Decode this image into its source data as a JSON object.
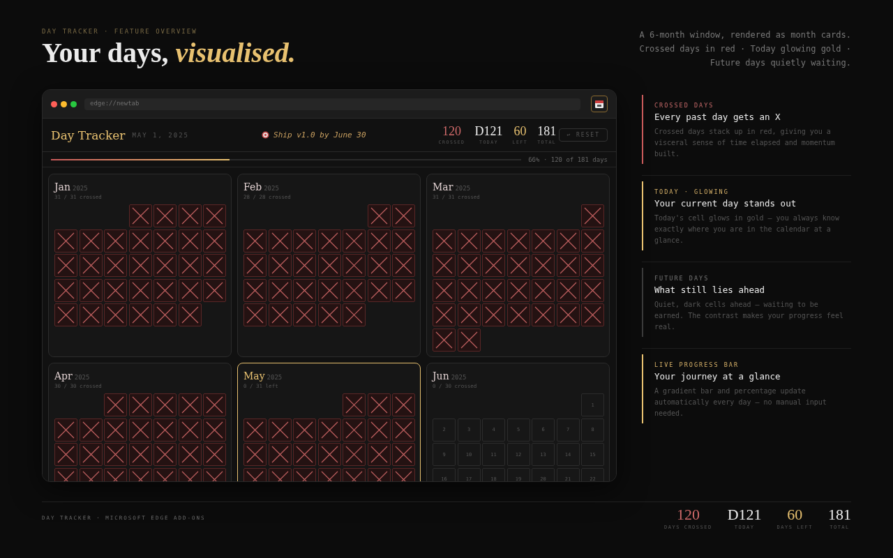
{
  "header": {
    "eyebrow": "DAY TRACKER · FEATURE OVERVIEW",
    "title_plain": "Your days,",
    "title_accent": "visualised.",
    "intro": "A 6-month window, rendered as month cards. Crossed days in red · Today glowing gold · Future days quietly waiting."
  },
  "browser": {
    "address": "edge://newtab"
  },
  "app": {
    "title": "Day Tracker",
    "date": "MAY 1, 2025",
    "goal": "Ship v1.0 by June 30",
    "stats": [
      {
        "kind": "crossed",
        "value": "120",
        "label": "CROSSED"
      },
      {
        "kind": "today",
        "value": "D121",
        "label": "TODAY"
      },
      {
        "kind": "left",
        "value": "60",
        "label": "LEFT"
      },
      {
        "kind": "total",
        "value": "181",
        "label": "TOTAL"
      }
    ],
    "reset": "↩ RESET",
    "progress": {
      "level": 0.38,
      "text": "66% · 120 of 181 days"
    }
  },
  "months": [
    {
      "name": "Jan",
      "year": "2025",
      "summary": "31 / 31 crossed",
      "current": false,
      "cells": [
        {
          "kind": "blank"
        },
        {
          "kind": "blank"
        },
        {
          "kind": "blank"
        },
        {
          "kind": "crossed"
        },
        {
          "kind": "crossed"
        },
        {
          "kind": "crossed"
        },
        {
          "kind": "crossed"
        },
        {
          "kind": "crossed"
        },
        {
          "kind": "crossed"
        },
        {
          "kind": "crossed"
        },
        {
          "kind": "crossed"
        },
        {
          "kind": "crossed"
        },
        {
          "kind": "crossed"
        },
        {
          "kind": "crossed"
        },
        {
          "kind": "crossed"
        },
        {
          "kind": "crossed"
        },
        {
          "kind": "crossed"
        },
        {
          "kind": "crossed"
        },
        {
          "kind": "crossed"
        },
        {
          "kind": "crossed"
        },
        {
          "kind": "crossed"
        },
        {
          "kind": "crossed"
        },
        {
          "kind": "crossed"
        },
        {
          "kind": "crossed"
        },
        {
          "kind": "crossed"
        },
        {
          "kind": "crossed"
        },
        {
          "kind": "crossed"
        },
        {
          "kind": "crossed"
        },
        {
          "kind": "crossed"
        },
        {
          "kind": "crossed"
        },
        {
          "kind": "crossed"
        },
        {
          "kind": "crossed"
        },
        {
          "kind": "crossed"
        },
        {
          "kind": "crossed"
        }
      ]
    },
    {
      "name": "Feb",
      "year": "2025",
      "summary": "28 / 28 crossed",
      "current": false,
      "cells": [
        {
          "kind": "blank"
        },
        {
          "kind": "blank"
        },
        {
          "kind": "blank"
        },
        {
          "kind": "blank"
        },
        {
          "kind": "blank"
        },
        {
          "kind": "crossed"
        },
        {
          "kind": "crossed"
        },
        {
          "kind": "crossed"
        },
        {
          "kind": "crossed"
        },
        {
          "kind": "crossed"
        },
        {
          "kind": "crossed"
        },
        {
          "kind": "crossed"
        },
        {
          "kind": "crossed"
        },
        {
          "kind": "crossed"
        },
        {
          "kind": "crossed"
        },
        {
          "kind": "crossed"
        },
        {
          "kind": "crossed"
        },
        {
          "kind": "crossed"
        },
        {
          "kind": "crossed"
        },
        {
          "kind": "crossed"
        },
        {
          "kind": "crossed"
        },
        {
          "kind": "crossed"
        },
        {
          "kind": "crossed"
        },
        {
          "kind": "crossed"
        },
        {
          "kind": "crossed"
        },
        {
          "kind": "crossed"
        },
        {
          "kind": "crossed"
        },
        {
          "kind": "crossed"
        },
        {
          "kind": "crossed"
        },
        {
          "kind": "crossed"
        },
        {
          "kind": "crossed"
        },
        {
          "kind": "crossed"
        },
        {
          "kind": "crossed"
        }
      ]
    },
    {
      "name": "Mar",
      "year": "2025",
      "summary": "31 / 31 crossed",
      "current": false,
      "cells": [
        {
          "kind": "blank"
        },
        {
          "kind": "blank"
        },
        {
          "kind": "blank"
        },
        {
          "kind": "blank"
        },
        {
          "kind": "blank"
        },
        {
          "kind": "blank"
        },
        {
          "kind": "crossed"
        },
        {
          "kind": "crossed"
        },
        {
          "kind": "crossed"
        },
        {
          "kind": "crossed"
        },
        {
          "kind": "crossed"
        },
        {
          "kind": "crossed"
        },
        {
          "kind": "crossed"
        },
        {
          "kind": "crossed"
        },
        {
          "kind": "crossed"
        },
        {
          "kind": "crossed"
        },
        {
          "kind": "crossed"
        },
        {
          "kind": "crossed"
        },
        {
          "kind": "crossed"
        },
        {
          "kind": "crossed"
        },
        {
          "kind": "crossed"
        },
        {
          "kind": "crossed"
        },
        {
          "kind": "crossed"
        },
        {
          "kind": "crossed"
        },
        {
          "kind": "crossed"
        },
        {
          "kind": "crossed"
        },
        {
          "kind": "crossed"
        },
        {
          "kind": "crossed"
        },
        {
          "kind": "crossed"
        },
        {
          "kind": "crossed"
        },
        {
          "kind": "crossed"
        },
        {
          "kind": "crossed"
        },
        {
          "kind": "crossed"
        },
        {
          "kind": "crossed"
        },
        {
          "kind": "crossed"
        },
        {
          "kind": "crossed"
        },
        {
          "kind": "crossed"
        }
      ]
    },
    {
      "name": "Apr",
      "year": "2025",
      "summary": "30 / 30 crossed",
      "current": false,
      "cells": [
        {
          "kind": "blank"
        },
        {
          "kind": "blank"
        },
        {
          "kind": "crossed"
        },
        {
          "kind": "crossed"
        },
        {
          "kind": "crossed"
        },
        {
          "kind": "crossed"
        },
        {
          "kind": "crossed"
        },
        {
          "kind": "crossed"
        },
        {
          "kind": "crossed"
        },
        {
          "kind": "crossed"
        },
        {
          "kind": "crossed"
        },
        {
          "kind": "crossed"
        },
        {
          "kind": "crossed"
        },
        {
          "kind": "crossed"
        },
        {
          "kind": "crossed"
        },
        {
          "kind": "crossed"
        },
        {
          "kind": "crossed"
        },
        {
          "kind": "crossed"
        },
        {
          "kind": "crossed"
        },
        {
          "kind": "crossed"
        },
        {
          "kind": "crossed"
        },
        {
          "kind": "crossed"
        },
        {
          "kind": "crossed"
        },
        {
          "kind": "crossed"
        },
        {
          "kind": "crossed"
        },
        {
          "kind": "crossed"
        },
        {
          "kind": "crossed"
        },
        {
          "kind": "crossed"
        }
      ]
    },
    {
      "name": "May",
      "year": "2025",
      "summary": "0 / 31 left",
      "current": true,
      "cells": [
        {
          "kind": "blank"
        },
        {
          "kind": "blank"
        },
        {
          "kind": "blank"
        },
        {
          "kind": "blank"
        },
        {
          "kind": "crossed"
        },
        {
          "kind": "crossed"
        },
        {
          "kind": "crossed"
        },
        {
          "kind": "crossed"
        },
        {
          "kind": "crossed"
        },
        {
          "kind": "crossed"
        },
        {
          "kind": "crossed"
        },
        {
          "kind": "crossed"
        },
        {
          "kind": "crossed"
        },
        {
          "kind": "crossed"
        },
        {
          "kind": "crossed"
        },
        {
          "kind": "crossed"
        },
        {
          "kind": "crossed"
        },
        {
          "kind": "crossed"
        },
        {
          "kind": "crossed"
        },
        {
          "kind": "crossed"
        },
        {
          "kind": "crossed"
        },
        {
          "kind": "crossed"
        },
        {
          "kind": "crossed"
        },
        {
          "kind": "crossed"
        },
        {
          "kind": "crossed"
        },
        {
          "kind": "crossed"
        },
        {
          "kind": "crossed"
        },
        {
          "kind": "crossed"
        }
      ]
    },
    {
      "name": "Jun",
      "year": "2025",
      "summary": "0 / 30 crossed",
      "current": false,
      "cells": [
        {
          "kind": "blank"
        },
        {
          "kind": "blank"
        },
        {
          "kind": "blank"
        },
        {
          "kind": "blank"
        },
        {
          "kind": "blank"
        },
        {
          "kind": "blank"
        },
        {
          "kind": "future",
          "label": "1"
        },
        {
          "kind": "future",
          "label": "2"
        },
        {
          "kind": "future",
          "label": "3"
        },
        {
          "kind": "future",
          "label": "4"
        },
        {
          "kind": "future",
          "label": "5"
        },
        {
          "kind": "future",
          "label": "6"
        },
        {
          "kind": "future",
          "label": "7"
        },
        {
          "kind": "future",
          "label": "8"
        },
        {
          "kind": "future",
          "label": "9"
        },
        {
          "kind": "future",
          "label": "10"
        },
        {
          "kind": "future",
          "label": "11"
        },
        {
          "kind": "future",
          "label": "12"
        },
        {
          "kind": "future",
          "label": "13"
        },
        {
          "kind": "future",
          "label": "14"
        },
        {
          "kind": "future",
          "label": "15"
        },
        {
          "kind": "future",
          "label": "16"
        },
        {
          "kind": "future",
          "label": "17"
        },
        {
          "kind": "future",
          "label": "18"
        },
        {
          "kind": "future",
          "label": "19"
        },
        {
          "kind": "future",
          "label": "20"
        },
        {
          "kind": "future",
          "label": "21"
        },
        {
          "kind": "future",
          "label": "22"
        }
      ]
    }
  ],
  "features": [
    {
      "kind": "crossed",
      "label": "CROSSED DAYS",
      "title": "Every past day gets an X",
      "text": "Crossed days stack up in red, giving you a visceral sense of time elapsed and momentum built."
    },
    {
      "kind": "today",
      "label": "TODAY · GLOWING",
      "title": "Your current day stands out",
      "text": "Today's cell glows in gold — you always know exactly where you are in the calendar at a glance."
    },
    {
      "kind": "future",
      "label": "FUTURE DAYS",
      "title": "What still lies ahead",
      "text": "Quiet, dark cells ahead — waiting to be earned. The contrast makes your progress feel real."
    },
    {
      "kind": "progress",
      "label": "LIVE PROGRESS BAR",
      "title": "Your journey at a glance",
      "text": "A gradient bar and percentage update automatically every day — no manual input needed."
    }
  ],
  "footer": {
    "credit": "DAY TRACKER · MICROSOFT EDGE ADD-ONS",
    "stats": [
      {
        "kind": "crossed",
        "value": "120",
        "label": "DAYS CROSSED"
      },
      {
        "kind": "today",
        "value": "D121",
        "label": "TODAY"
      },
      {
        "kind": "left",
        "value": "60",
        "label": "DAYS LEFT"
      },
      {
        "kind": "total",
        "value": "181",
        "label": "TOTAL"
      }
    ]
  }
}
